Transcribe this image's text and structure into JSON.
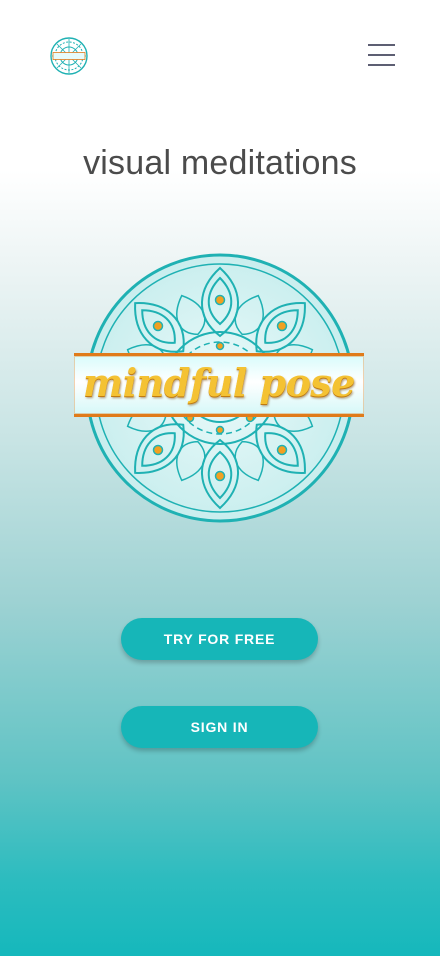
{
  "header": {
    "logo_icon": "mindful-pose-mandala-logo",
    "logo_text": "mindful pose",
    "menu_icon": "hamburger-menu-icon"
  },
  "hero": {
    "title": "visual meditations",
    "logo_icon": "mandala-icon",
    "logo_text": "mindful pose"
  },
  "actions": {
    "try_label": "TRY FOR FREE",
    "signin_label": "SIGN IN"
  },
  "colors": {
    "accent": "#16b6b8",
    "mandala_stroke": "#1fb1b3",
    "banner_border": "#e07b1a",
    "banner_text": "#f4c233",
    "title_text": "#4b4b4b"
  }
}
